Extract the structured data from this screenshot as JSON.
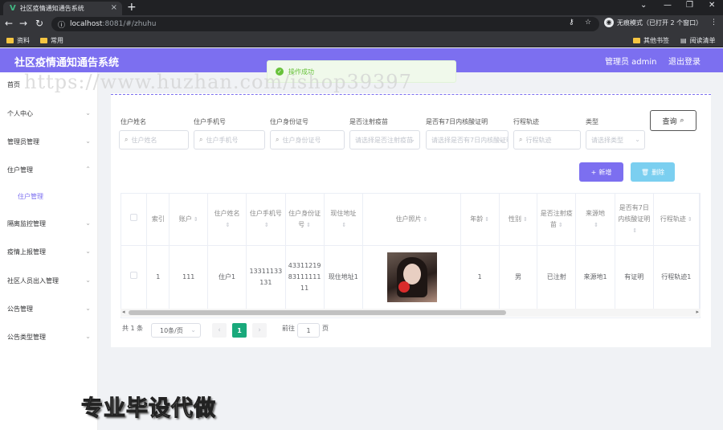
{
  "browser": {
    "tab_title": "社区疫情通知通告系统",
    "url_host": "localhost",
    "url_path": ":8081/#/zhuhu",
    "incognito_label": "无痕模式（已打开 2 个窗口）",
    "bookmarks": [
      "资料",
      "常用"
    ],
    "bookmarks_right": [
      "其他书签",
      "阅读清单"
    ]
  },
  "header": {
    "title": "社区疫情通知通告系统",
    "user": "管理员 admin",
    "logout": "退出登录"
  },
  "toast": {
    "message": "操作成功"
  },
  "sidebar": {
    "items": [
      {
        "label": "首页"
      },
      {
        "label": "个人中心"
      },
      {
        "label": "管理员管理"
      },
      {
        "label": "住户管理"
      },
      {
        "label": "隔离监控管理"
      },
      {
        "label": "疫情上报管理"
      },
      {
        "label": "社区人员出入管理"
      },
      {
        "label": "公告管理"
      },
      {
        "label": "公告类型管理"
      }
    ],
    "sub_item": "住户管理"
  },
  "filters": {
    "labels": [
      "住户姓名",
      "住户手机号",
      "住户身份证号",
      "是否注射疫苗",
      "是否有7日内核酸证明",
      "行程轨迹",
      "类型"
    ],
    "placeholders": [
      "住户姓名",
      "住户手机号",
      "住户身份证号",
      "请选择是否注射疫苗",
      "请选择是否有7日内核酸证明",
      "行程轨迹",
      "请选择类型"
    ],
    "query_button": "查询"
  },
  "actions": {
    "add": "新增",
    "delete": "删除"
  },
  "table": {
    "headers": [
      "索引",
      "账户",
      "住户姓名",
      "住户手机号",
      "住户身份证号",
      "现住地址",
      "住户照片",
      "年龄",
      "性别",
      "是否注射疫苗",
      "来源地",
      "是否有7日内核酸证明",
      "行程轨迹"
    ],
    "rows": [
      [
        "1",
        "111",
        "住户1",
        "13311133131",
        "433112198311111111",
        "现住地址1",
        "",
        "1",
        "男",
        "已注射",
        "来源地1",
        "有证明",
        "行程轨迹1"
      ]
    ]
  },
  "pagination": {
    "total": "共 1 条",
    "page_size": "10条/页",
    "current": "1",
    "goto_prefix": "前往",
    "goto_value": "1",
    "goto_suffix": "页"
  },
  "watermark": "https://www.huzhan.com/ishop39397",
  "overlay_text": "专业毕设代做",
  "colors": {
    "primary": "#7c6ff0",
    "secondary": "#7bcff0",
    "pager_active": "#19a97b",
    "success": "#67c23a"
  }
}
